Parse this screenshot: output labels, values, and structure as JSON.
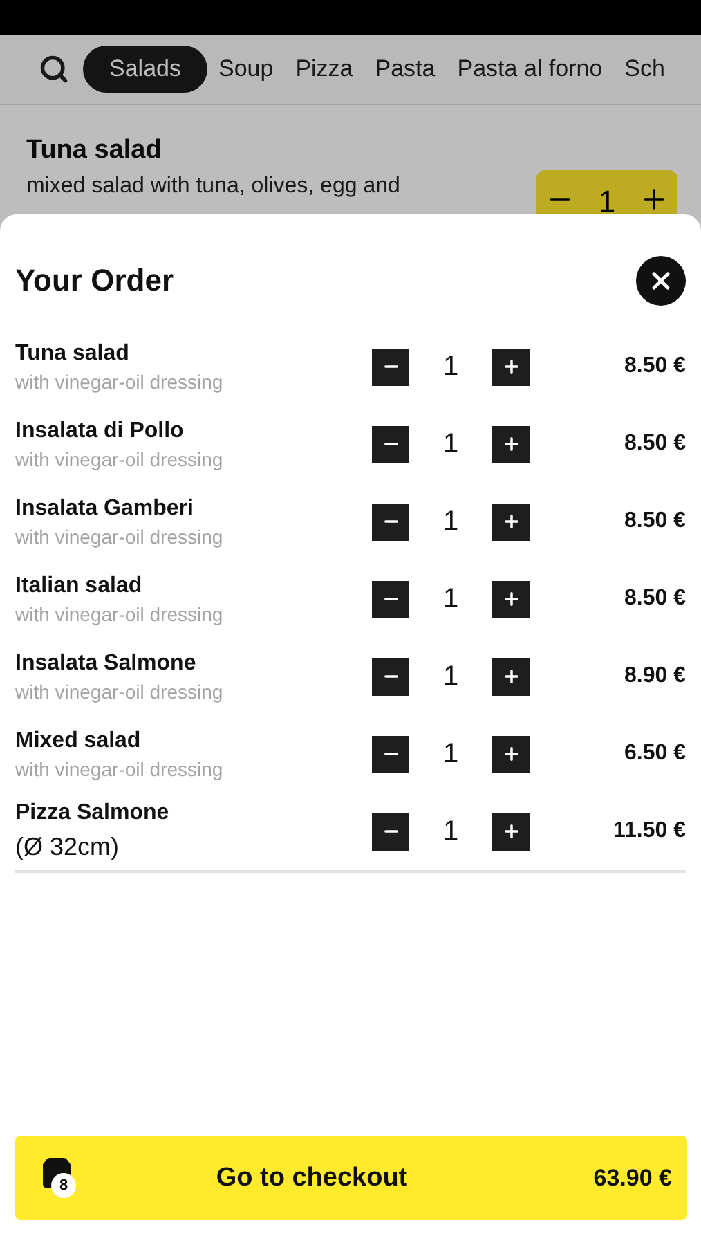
{
  "categories": [
    {
      "label": "Salads",
      "selected": true
    },
    {
      "label": "Soup",
      "selected": false
    },
    {
      "label": "Pizza",
      "selected": false
    },
    {
      "label": "Pasta",
      "selected": false
    },
    {
      "label": "Pasta al forno",
      "selected": false
    },
    {
      "label": "Sch",
      "selected": false
    }
  ],
  "menu_item": {
    "name": "Tuna salad",
    "description": "mixed salad with tuna, olives, egg and",
    "quantity": "1"
  },
  "order": {
    "title": "Your Order",
    "items": [
      {
        "name": "Tuna salad",
        "note": "with vinegar-oil dressing",
        "kind": "dressing",
        "quantity": "1",
        "price": "8.50 €"
      },
      {
        "name": "Insalata di Pollo",
        "note": "with vinegar-oil dressing",
        "kind": "dressing",
        "quantity": "1",
        "price": "8.50 €"
      },
      {
        "name": "Insalata Gamberi",
        "note": "with vinegar-oil dressing",
        "kind": "dressing",
        "quantity": "1",
        "price": "8.50 €"
      },
      {
        "name": "Italian salad",
        "note": "with vinegar-oil dressing",
        "kind": "dressing",
        "quantity": "1",
        "price": "8.50 €"
      },
      {
        "name": "Insalata Salmone",
        "note": "with vinegar-oil dressing",
        "kind": "dressing",
        "quantity": "1",
        "price": "8.90 €"
      },
      {
        "name": "Mixed salad",
        "note": "with vinegar-oil dressing",
        "kind": "dressing",
        "quantity": "1",
        "price": "6.50 €"
      },
      {
        "name": "Pizza Salmone",
        "note": "(Ø 32cm)",
        "kind": "size",
        "quantity": "1",
        "price": "11.50 €"
      }
    ],
    "checkout": {
      "label": "Go to checkout",
      "count": "8",
      "total": "63.90 €"
    }
  }
}
